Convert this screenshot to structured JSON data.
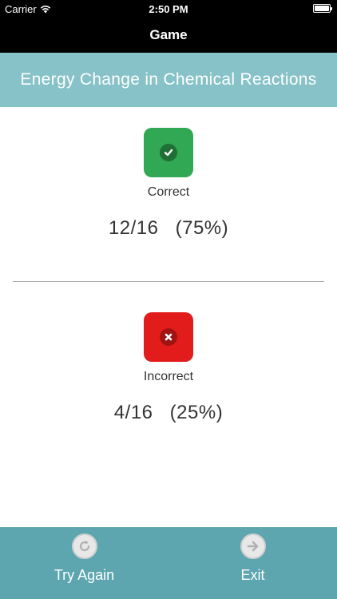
{
  "status_bar": {
    "carrier": "Carrier",
    "time": "2:50 PM"
  },
  "nav": {
    "title": "Game"
  },
  "quiz": {
    "title": "Energy Change in Chemical Reactions"
  },
  "results": {
    "correct": {
      "label": "Correct",
      "score": "12/16 (75%)",
      "color": "#31a853"
    },
    "incorrect": {
      "label": "Incorrect",
      "score": "4/16 (25%)",
      "color": "#e21b1b"
    }
  },
  "bottom_bar": {
    "try_again_label": "Try Again",
    "exit_label": "Exit",
    "try_again_icon": "refresh-icon",
    "exit_icon": "arrow-right-icon",
    "color": "#5da6b0"
  }
}
